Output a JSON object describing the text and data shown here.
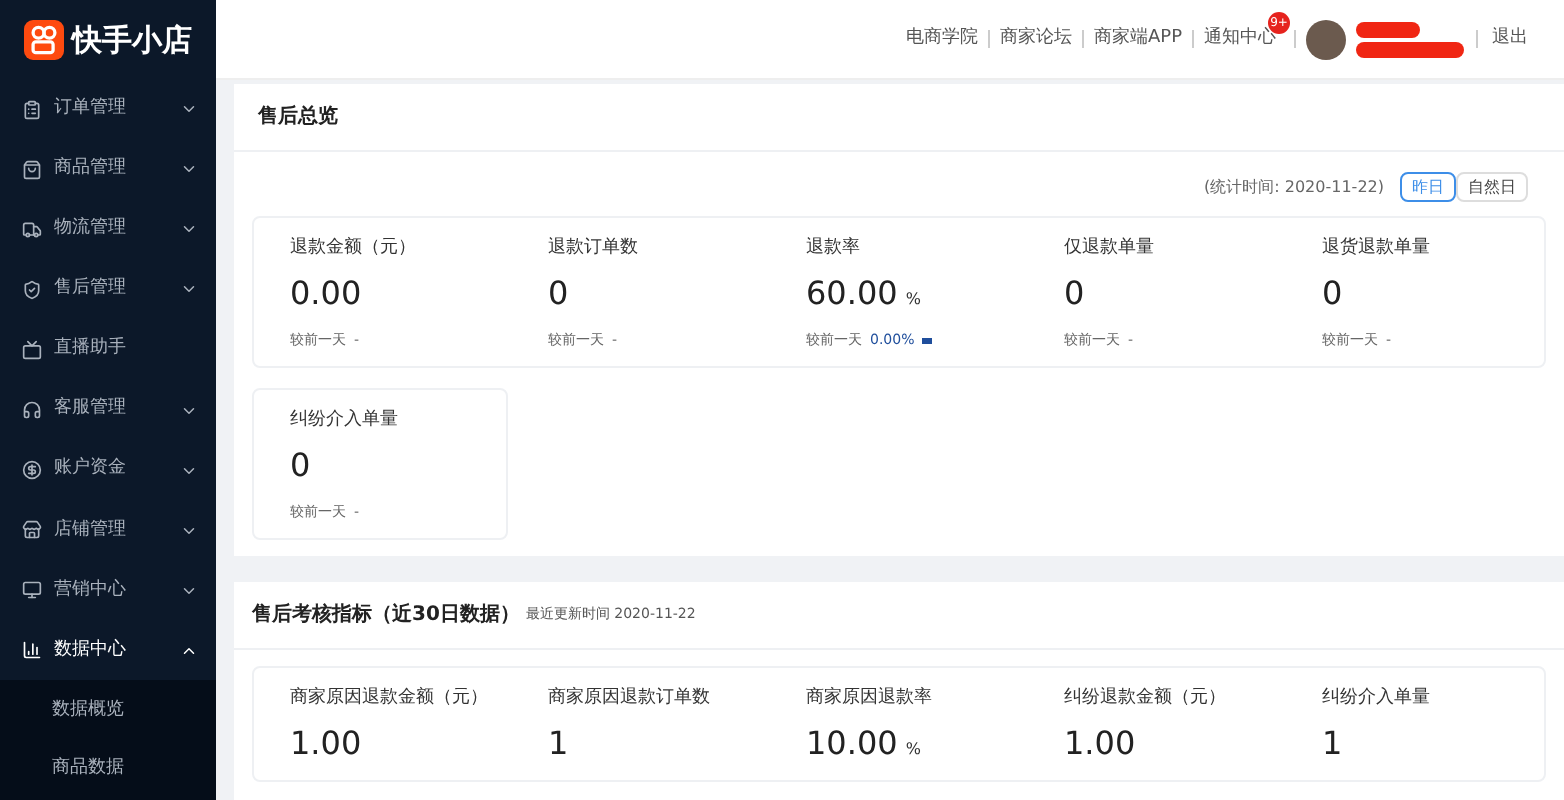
{
  "logo": {
    "text": "快手小店"
  },
  "sidebar": {
    "items": [
      {
        "label": "订单管理",
        "kind": "group",
        "expanded": false
      },
      {
        "label": "商品管理",
        "kind": "group",
        "expanded": false
      },
      {
        "label": "物流管理",
        "kind": "group",
        "expanded": false
      },
      {
        "label": "售后管理",
        "kind": "group",
        "expanded": false
      },
      {
        "label": "直播助手",
        "kind": "link"
      },
      {
        "label": "客服管理",
        "kind": "group",
        "expanded": false
      },
      {
        "label": "账户资金",
        "kind": "group",
        "expanded": false
      },
      {
        "label": "店铺管理",
        "kind": "group",
        "expanded": false
      },
      {
        "label": "营销中心",
        "kind": "group",
        "expanded": false
      },
      {
        "label": "数据中心",
        "kind": "group",
        "expanded": true,
        "children": [
          {
            "label": "数据概览"
          },
          {
            "label": "商品数据"
          }
        ]
      }
    ]
  },
  "header": {
    "links": [
      "电商学院",
      "商家论坛",
      "商家端APP",
      "通知中心"
    ],
    "notification_badge": "9+",
    "logout": "退出"
  },
  "overview": {
    "title": "售后总览",
    "stat_time": "(统计时间: 2020-11-22)",
    "range_tabs": [
      {
        "label": "昨日",
        "selected": true
      },
      {
        "label": "自然日",
        "selected": false
      }
    ],
    "stats": [
      {
        "label": "退款金额（元）",
        "value": "0.00",
        "compare_label": "较前一天",
        "compare": "-",
        "trend_flat": false
      },
      {
        "label": "退款订单数",
        "value": "0",
        "compare_label": "较前一天",
        "compare": "-",
        "trend_flat": false
      },
      {
        "label": "退款率",
        "value": "60.00",
        "unit": "%",
        "compare_label": "较前一天",
        "compare": "0.00%",
        "trend_flat": true
      },
      {
        "label": "仅退款单量",
        "value": "0",
        "compare_label": "较前一天",
        "compare": "-",
        "trend_flat": false
      },
      {
        "label": "退货退款单量",
        "value": "0",
        "compare_label": "较前一天",
        "compare": "-",
        "trend_flat": false
      }
    ],
    "dispute": {
      "label": "纠纷介入单量",
      "value": "0",
      "compare_label": "较前一天",
      "compare": "-",
      "trend_flat": false
    }
  },
  "assessment": {
    "title": "售后考核指标（近30日数据）",
    "updated": "最近更新时间 2020-11-22",
    "stats": [
      {
        "label": "商家原因退款金额（元）",
        "value": "1.00"
      },
      {
        "label": "商家原因退款订单数",
        "value": "1"
      },
      {
        "label": "商家原因退款率",
        "value": "10.00",
        "unit": "%"
      },
      {
        "label": "纠纷退款金额（元）",
        "value": "1.00"
      },
      {
        "label": "纠纷介入单量",
        "value": "1"
      }
    ]
  }
}
